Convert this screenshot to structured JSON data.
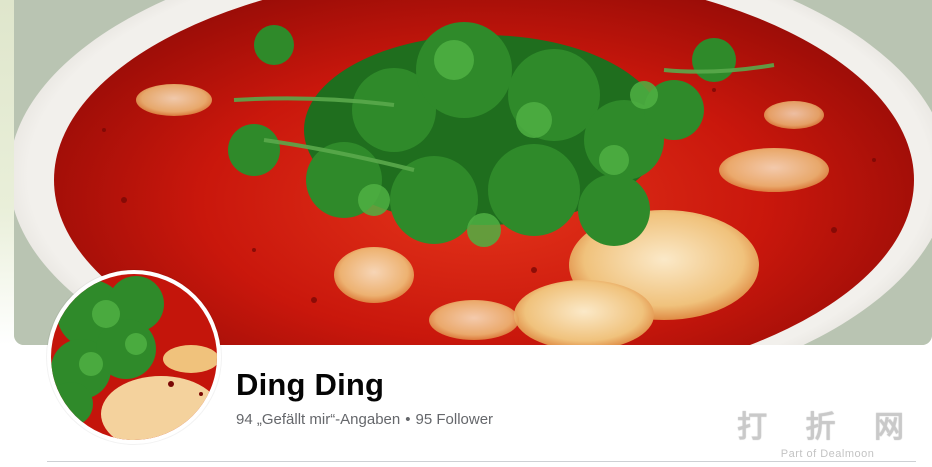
{
  "profile": {
    "name": "Ding Ding",
    "likes": "94 „Gefällt mir“-Angaben",
    "separator": "•",
    "followers": "95 Follower"
  },
  "watermark": {
    "title": "打 折 网",
    "subtitle": "Part of Dealmoon"
  },
  "colors": {
    "name_text": "#050505",
    "stats_text": "#65676b",
    "divider": "#ced0d4",
    "soup_red": "#c8160d",
    "cilantro_green": "#2f8a2a"
  }
}
